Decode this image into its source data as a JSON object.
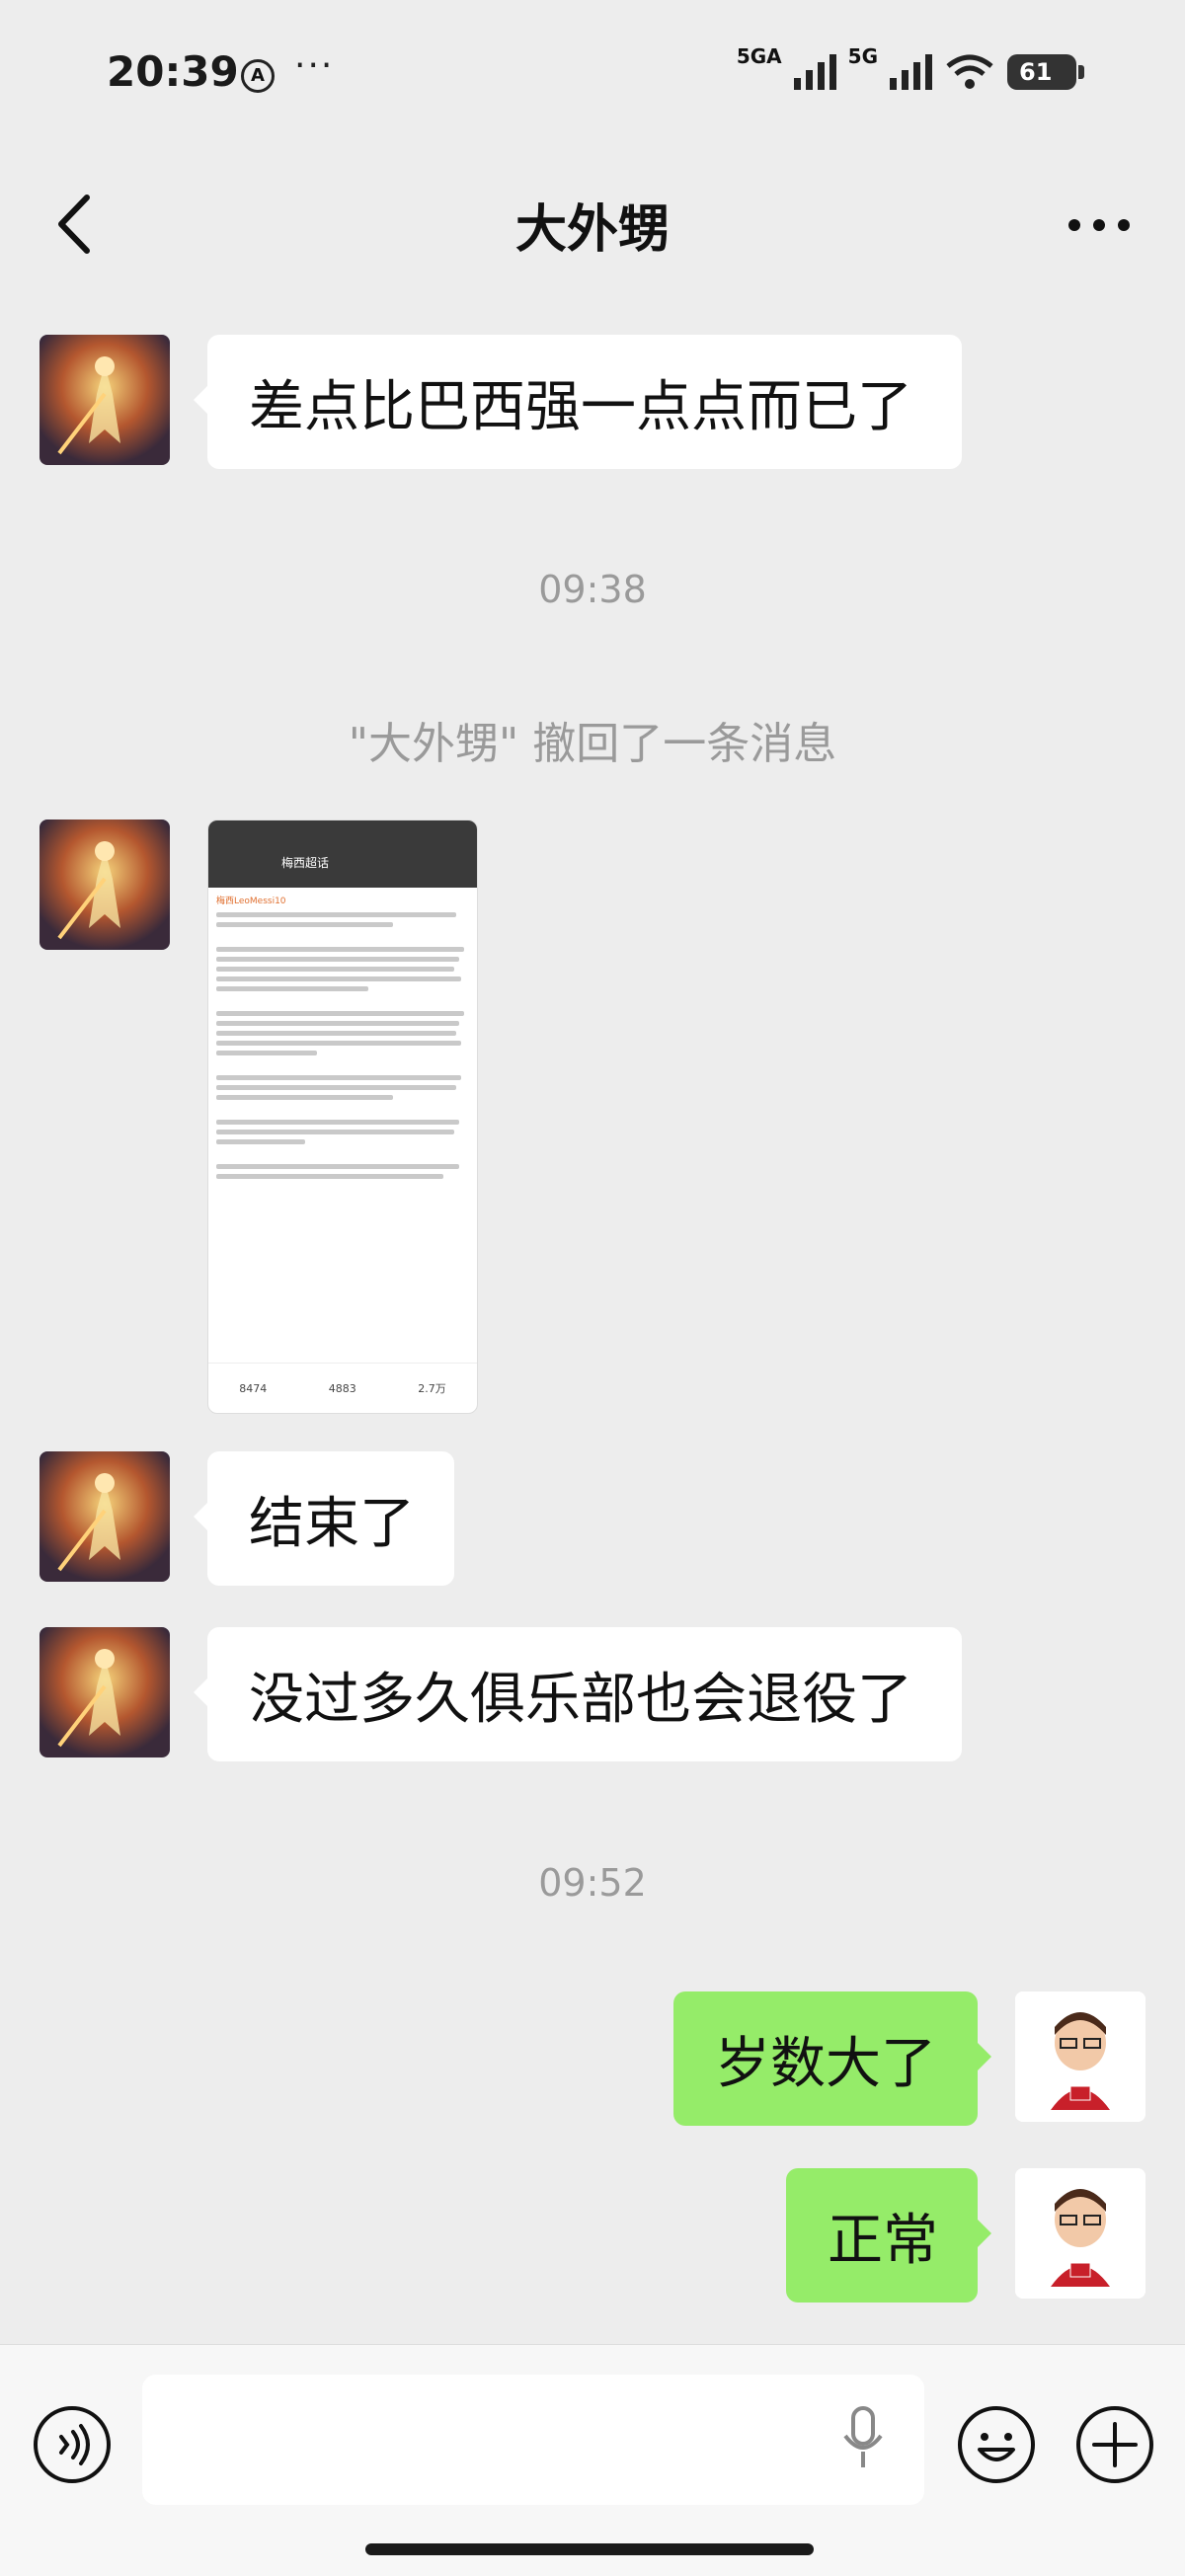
{
  "status_bar": {
    "time": "20:39",
    "network1": "5GA",
    "network2": "5G",
    "battery": "61"
  },
  "header": {
    "title": "大外甥"
  },
  "messages": [
    {
      "side": "left",
      "type": "text",
      "text": "差点比巴西强一点点而已了"
    },
    {
      "type": "time",
      "text": "09:38"
    },
    {
      "type": "system",
      "text": "\"大外甥\" 撤回了一条消息"
    },
    {
      "side": "left",
      "type": "image",
      "image_title": "梅西超话",
      "image_author": "梅西LeoMessi10",
      "image_stats": [
        "8474",
        "4883",
        "2.7万"
      ]
    },
    {
      "side": "left",
      "type": "text",
      "text": "结束了"
    },
    {
      "side": "left",
      "type": "text",
      "text": "没过多久俱乐部也会退役了"
    },
    {
      "type": "time",
      "text": "09:52"
    },
    {
      "side": "right",
      "type": "text",
      "text": "岁数大了"
    },
    {
      "side": "right",
      "type": "text",
      "text": "正常"
    }
  ],
  "colors": {
    "background": "#ededed",
    "sent_bubble": "#95ec69",
    "received_bubble": "#ffffff"
  },
  "icons": {
    "back": "chevron-left-icon",
    "more": "more-dots-icon",
    "voice": "voice-icon",
    "mic": "microphone-icon",
    "emoji": "emoji-icon",
    "plus": "plus-icon"
  }
}
